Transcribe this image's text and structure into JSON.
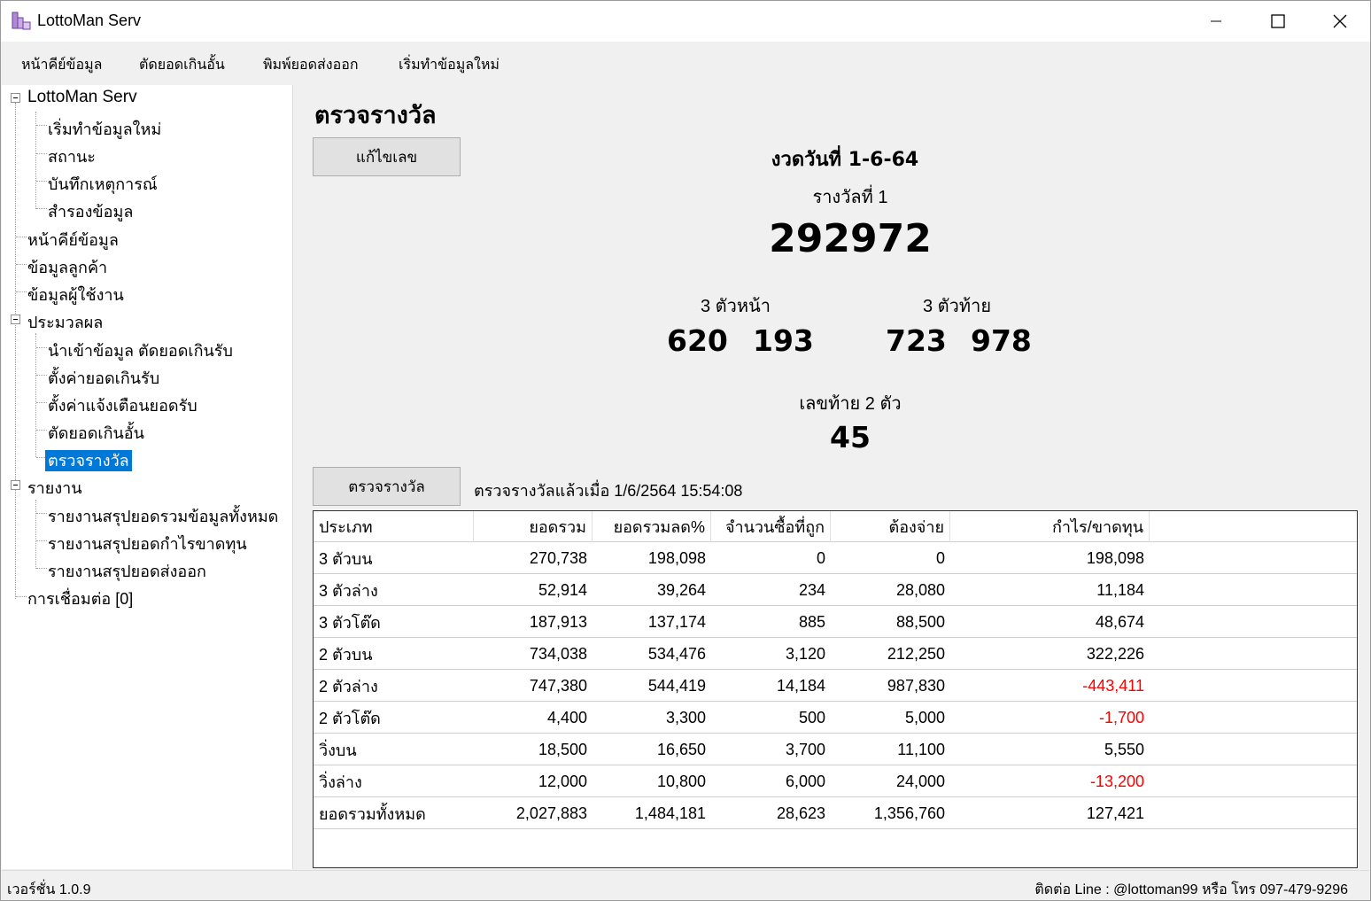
{
  "window": {
    "title": "LottoMan Serv"
  },
  "menu": {
    "items": [
      "หน้าคีย์ข้อมูล",
      "ตัดยอดเกินอั้น",
      "พิมพ์ยอดส่งออก",
      "เริ่มทำข้อมูลใหม่"
    ]
  },
  "tree": {
    "root": "LottoMan Serv",
    "root_children": [
      "เริ่มทำข้อมูลใหม่",
      "สถานะ",
      "บันทึกเหตุการณ์",
      "สำรองข้อมูล"
    ],
    "items": [
      "หน้าคีย์ข้อมูล",
      "ข้อมูลลูกค้า",
      "ข้อมูลผู้ใช้งาน"
    ],
    "process_label": "ประมวลผล",
    "process_children": [
      "นำเข้าข้อมูล ตัดยอดเกินรับ",
      "ตั้งค่ายอดเกินรับ",
      "ตั้งค่าแจ้งเตือนยอดรับ",
      "ตัดยอดเกินอั้น",
      "ตรวจรางวัล"
    ],
    "report_label": "รายงาน",
    "report_children": [
      "รายงานสรุปยอดรวมข้อมูลทั้งหมด",
      "รายงานสรุปยอดกำไรขาดทุน",
      "รายงานสรุปยอดส่งออก"
    ],
    "connection": "การเชื่อมต่อ [0]",
    "selected": "ตรวจรางวัล"
  },
  "main": {
    "title": "ตรวจรางวัล",
    "edit_button": "แก้ไขเลข",
    "check_button": "ตรวจรางวัล",
    "draw_date": "งวดวันที่ 1-6-64",
    "first_prize_label": "รางวัลที่ 1",
    "first_prize": "292972",
    "front3_label": "3 ตัวหน้า",
    "front3_a": "620",
    "front3_b": "193",
    "back3_label": "3 ตัวท้าย",
    "back3_a": "723",
    "back3_b": "978",
    "last2_label": "เลขท้าย 2 ตัว",
    "last2": "45",
    "checked_at": "ตรวจรางวัลแล้วเมื่อ 1/6/2564 15:54:08"
  },
  "grid": {
    "headers": [
      "ประเภท",
      "ยอดรวม",
      "ยอดรวมลด%",
      "จำนวนซื้อที่ถูก",
      "ต้องจ่าย",
      "กำไร/ขาดทุน"
    ],
    "rows": [
      [
        "3 ตัวบน",
        "270,738",
        "198,098",
        "0",
        "0",
        "198,098"
      ],
      [
        "3 ตัวล่าง",
        "52,914",
        "39,264",
        "234",
        "28,080",
        "11,184"
      ],
      [
        "3 ตัวโต๊ด",
        "187,913",
        "137,174",
        "885",
        "88,500",
        "48,674"
      ],
      [
        "2 ตัวบน",
        "734,038",
        "534,476",
        "3,120",
        "212,250",
        "322,226"
      ],
      [
        "2 ตัวล่าง",
        "747,380",
        "544,419",
        "14,184",
        "987,830",
        "-443,411"
      ],
      [
        "2 ตัวโต๊ด",
        "4,400",
        "3,300",
        "500",
        "5,000",
        "-1,700"
      ],
      [
        "วิ่งบน",
        "18,500",
        "16,650",
        "3,700",
        "11,100",
        "5,550"
      ],
      [
        "วิ่งล่าง",
        "12,000",
        "10,800",
        "6,000",
        "24,000",
        "-13,200"
      ],
      [
        "ยอดรวมทั้งหมด",
        "2,027,883",
        "1,484,181",
        "28,623",
        "1,356,760",
        "127,421"
      ]
    ],
    "negative_color": "#ff0000"
  },
  "status": {
    "version": "เวอร์ชั่น 1.0.9",
    "contact": "ติดต่อ Line : @lottoman99 หรือ โทร 097-479-9296"
  },
  "colors": {
    "selection": "#0078d7",
    "window_bg": "#f0f0f0"
  }
}
